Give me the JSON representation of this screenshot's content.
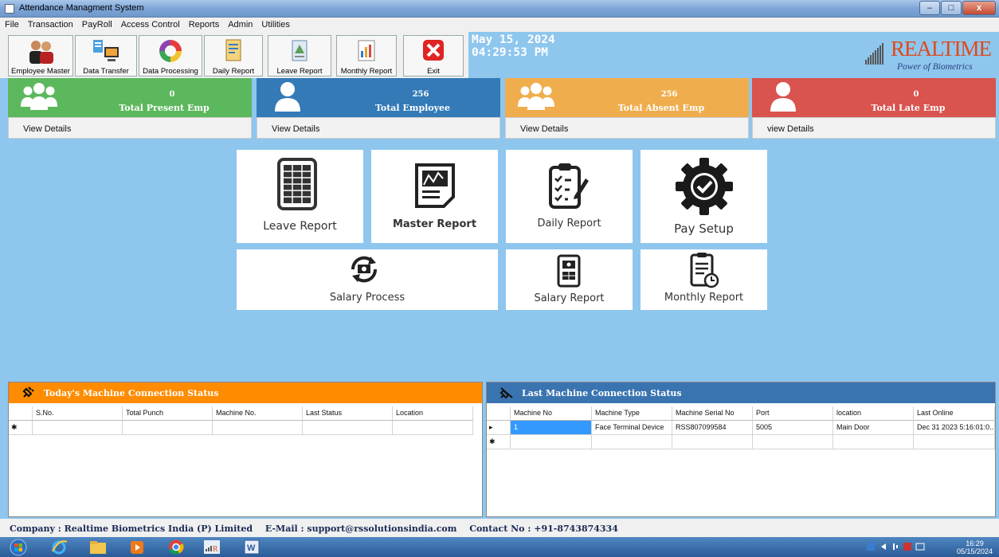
{
  "window": {
    "title": "Attendance Managment System",
    "controls": [
      "–",
      "□",
      "x"
    ]
  },
  "menu": [
    "File",
    "Transaction",
    "PayRoll",
    "Access Control",
    "Reports",
    "Admin",
    "Utilities"
  ],
  "toolbar": {
    "buttons": [
      {
        "label": "Employee Master",
        "icon": "people-icon"
      },
      {
        "label": "Data Transfer",
        "icon": "transfer-icon"
      },
      {
        "label": "Data Processing",
        "icon": "process-cycle-icon"
      },
      {
        "label": "Daily Report",
        "icon": "report-icon"
      },
      {
        "label": "Leave Report",
        "icon": "leave-report-icon"
      },
      {
        "label": "Monthly Report",
        "icon": "chart-report-icon"
      },
      {
        "label": "Exit",
        "icon": "exit-x-icon"
      }
    ],
    "date": "May 15, 2024",
    "time": "04:29:53 PM"
  },
  "logo": {
    "brand": "REALTIME",
    "tagline": "Power of Biometrics"
  },
  "stats": [
    {
      "value": "0",
      "caption": "Total Present Emp",
      "link": "View Details",
      "color": "#5cb85c",
      "icon": "group-icon"
    },
    {
      "value": "256",
      "caption": "Total Employee",
      "link": "View Details",
      "color": "#337ab7",
      "icon": "user-icon"
    },
    {
      "value": "256",
      "caption": "Total Absent Emp",
      "link": "View Details",
      "color": "#f0ad4e",
      "icon": "group-icon"
    },
    {
      "value": "0",
      "caption": "Total Late Emp",
      "link": "view Details",
      "color": "#d9534f",
      "icon": "user-icon"
    }
  ],
  "tiles": {
    "leave_report": "Leave Report",
    "master_report": "Master Report",
    "daily_report": "Daily Report",
    "pay_setup": "Pay Setup",
    "salary_process": "Salary Process",
    "salary_report": "Salary Report",
    "monthly_report": "Monthly Report"
  },
  "today_status": {
    "title": "Today's Machine Connection Status",
    "header_color": "#ff8c00",
    "columns": [
      "S.No.",
      "Total Punch",
      "Machine No.",
      "Last Status",
      "Location"
    ],
    "rows": []
  },
  "last_status": {
    "title": "Last Machine Connection Status",
    "header_color": "#3a74b0",
    "columns": [
      "Machine No",
      "Machine Type",
      "Machine Serial No",
      "Port",
      "location",
      "Last Online"
    ],
    "rows": [
      [
        "1",
        "Face Terminal Device",
        "RSS807099584",
        "5005",
        "Main Door",
        "Dec 31 2023  5:16:01:0..."
      ]
    ]
  },
  "footer": {
    "company": "Company : Realtime Biometrics India (P) Limited",
    "email": "E-Mail  : support@rssolutionsindia.com",
    "contact": "Contact No : +91-8743874334"
  },
  "taskbar": {
    "time": "16:29",
    "date": "05/15/2024"
  }
}
